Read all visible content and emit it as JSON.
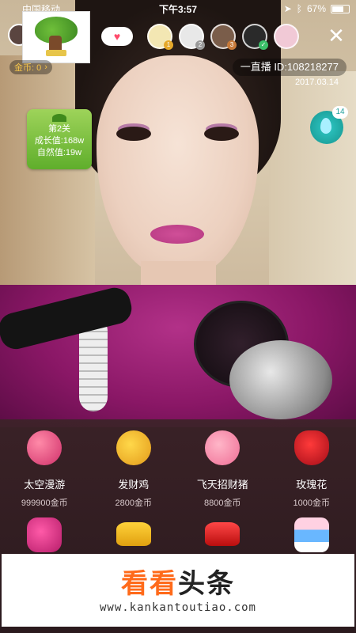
{
  "status_bar": {
    "carrier": "中国移动",
    "time": "下午3:57",
    "battery": "67%"
  },
  "top_bar": {
    "coin_label": "金币: 0",
    "room_id": "一直播 ID:108218277",
    "date": "2017.03.14",
    "viewers": [
      {
        "badge": "1",
        "color": "#f3e7b3"
      },
      {
        "badge": "2",
        "color": "#e8e8e8"
      },
      {
        "badge": "3",
        "color": "#7a5d4a"
      },
      {
        "badge": "✓",
        "color": "#2a2a2a"
      },
      {
        "badge": "",
        "color": "#f1c9d6"
      }
    ]
  },
  "level_card": {
    "level": "第2关",
    "growth": "成长值:168w",
    "nature": "自然值:19w"
  },
  "drop_badge": {
    "count": "14"
  },
  "gifts": [
    {
      "name": "太空漫游",
      "price": "999900金币",
      "icon": "planet-icon"
    },
    {
      "name": "发财鸡",
      "price": "2800金币",
      "icon": "chick-icon"
    },
    {
      "name": "飞天招财猪",
      "price": "8800金币",
      "icon": "pig-icon"
    },
    {
      "name": "玫瑰花",
      "price": "1000金币",
      "icon": "rose-icon"
    },
    {
      "name": "",
      "price": "",
      "icon": "monster-icon"
    },
    {
      "name": "",
      "price": "",
      "icon": "yellow-car-icon"
    },
    {
      "name": "",
      "price": "",
      "icon": "red-car-icon"
    },
    {
      "name": "",
      "price": "",
      "icon": "cake-icon"
    }
  ],
  "watermark": {
    "title_a": "看看",
    "title_b": "头条",
    "url": "www.kankantoutiao.com"
  }
}
